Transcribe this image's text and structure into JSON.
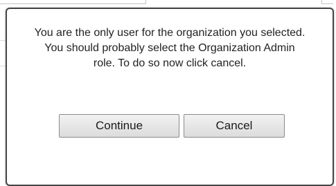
{
  "dialog": {
    "message_lines": [
      "You are the only user for the organization you selected.",
      "You should probably select the Organization Admin",
      "role.  To do so now click cancel."
    ],
    "continue_label": "Continue",
    "cancel_label": "Cancel"
  },
  "colors": {
    "dialog_border": "#444444",
    "button_border": "#8a8a8a",
    "text": "#222222"
  }
}
